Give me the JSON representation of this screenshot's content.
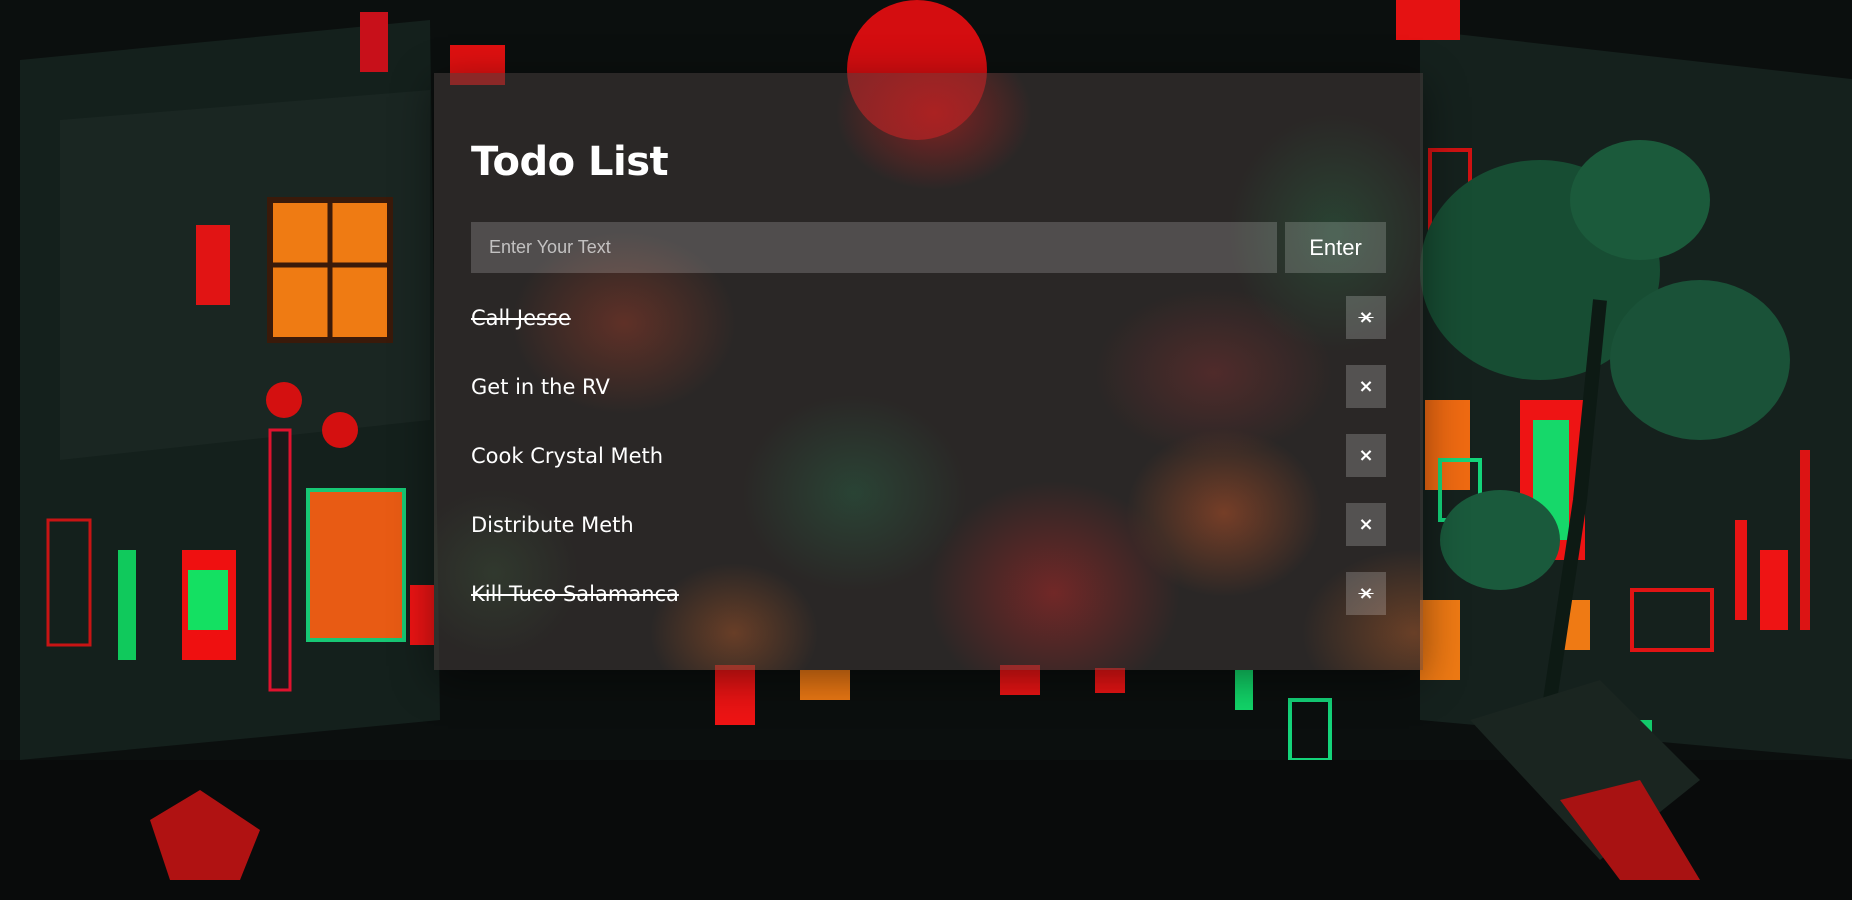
{
  "app": {
    "title": "Todo List",
    "accent": "#ffffff"
  },
  "input": {
    "placeholder": "Enter Your Text",
    "value": ""
  },
  "enter_button": {
    "label": "Enter"
  },
  "todos": [
    {
      "text": "Call Jesse",
      "completed": true,
      "delete_label": "×"
    },
    {
      "text": "Get in the RV",
      "completed": false,
      "delete_label": "×"
    },
    {
      "text": "Cook Crystal Meth",
      "completed": false,
      "delete_label": "×"
    },
    {
      "text": "Distribute Meth",
      "completed": false,
      "delete_label": "×"
    },
    {
      "text": "Kill Tuco Salamanca",
      "completed": true,
      "delete_label": "×"
    }
  ],
  "colors": {
    "panel": "#463c3a",
    "neon_red": "#e61818",
    "neon_green": "#12e07a",
    "neon_orange": "#f07a12"
  },
  "icons": {
    "delete": "close-icon"
  }
}
